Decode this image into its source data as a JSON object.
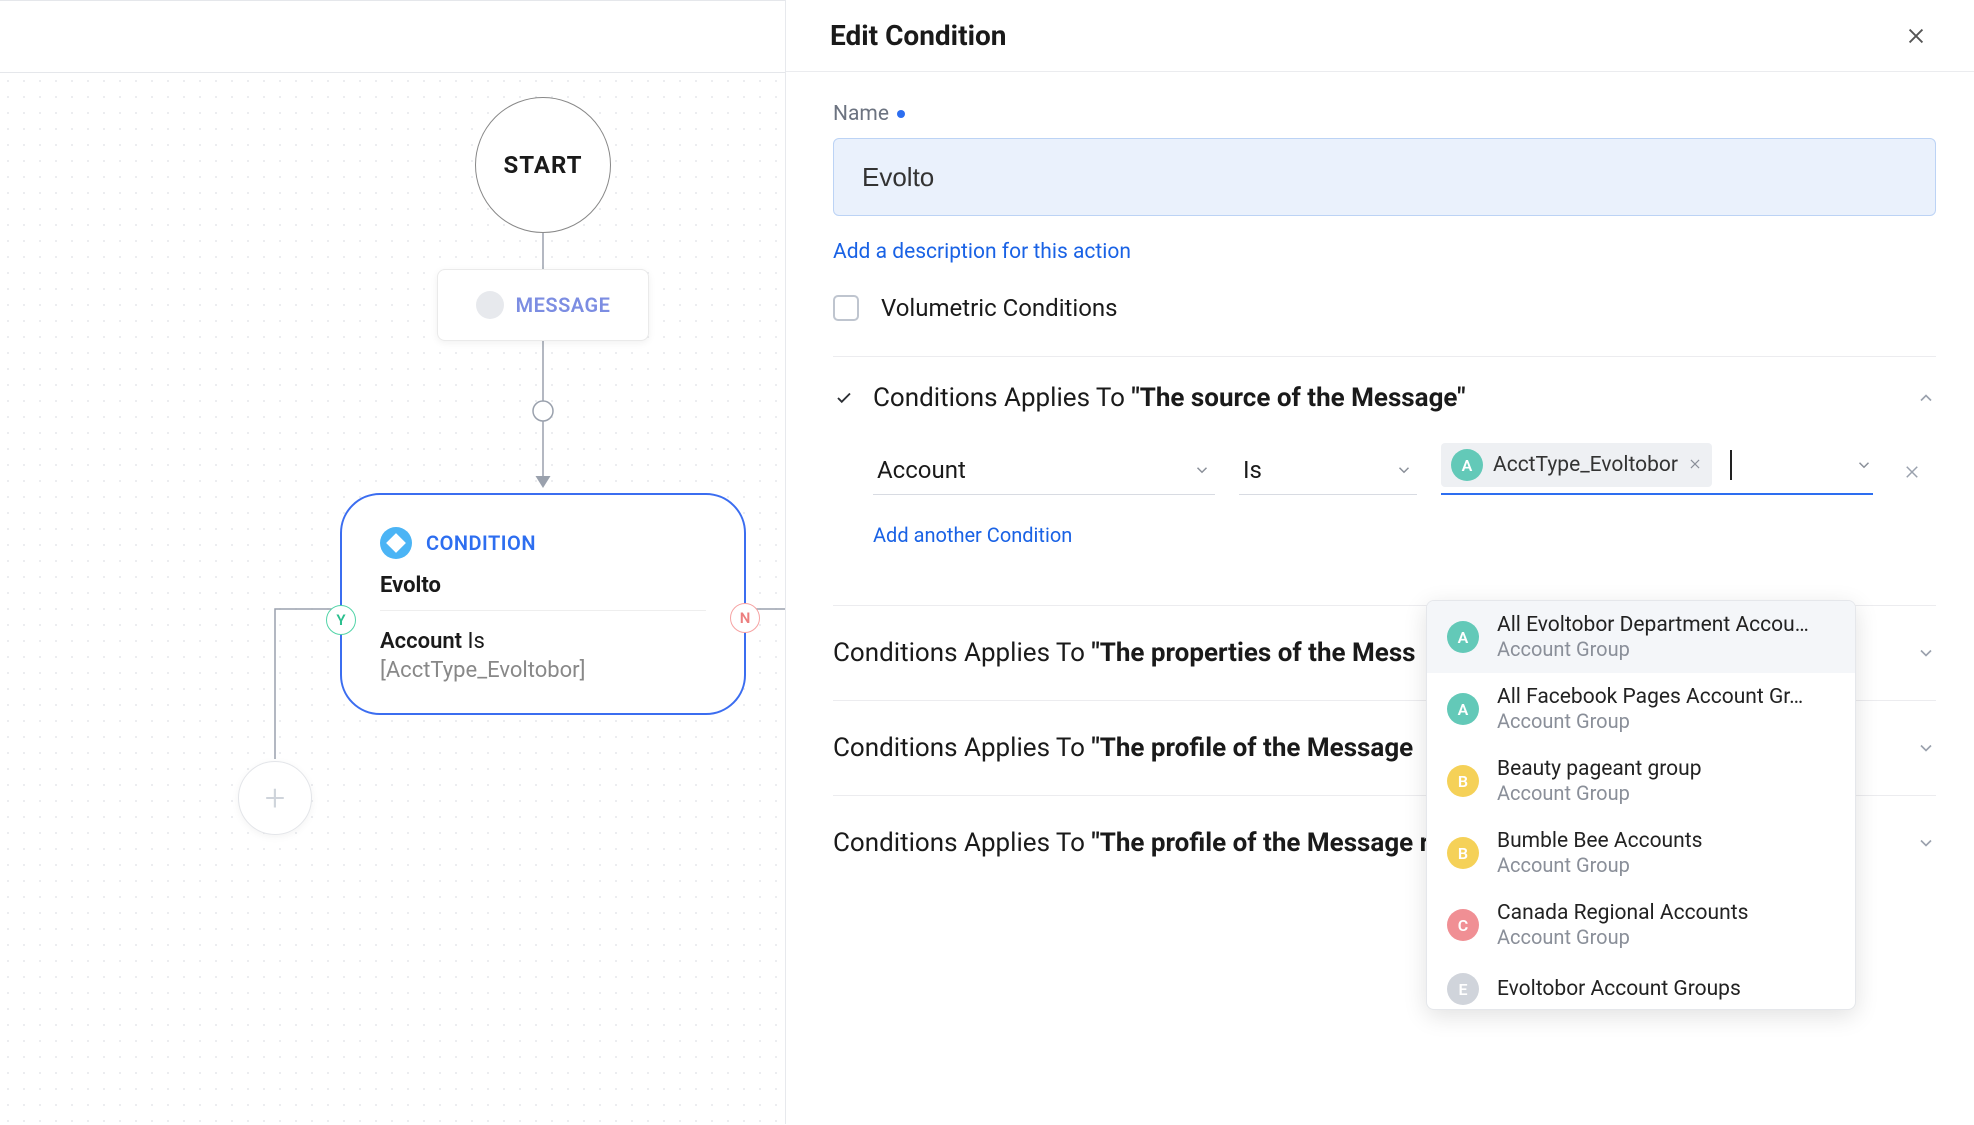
{
  "colors": {
    "accent": "#2d6ef0",
    "link": "#1962e5",
    "yes": "#2bbf8e",
    "no": "#ec7e7e"
  },
  "canvas": {
    "start_label": "START",
    "message_label": "MESSAGE",
    "add_button_glyph": "+",
    "yes_badge": "Y",
    "no_badge": "N",
    "condition_node": {
      "type_label": "CONDITION",
      "title": "Evolto",
      "field": "Account",
      "operator": "Is",
      "value_display": "[AcctType_Evoltobor]"
    }
  },
  "panel": {
    "title": "Edit Condition",
    "name_label": "Name",
    "name_value": "Evolto",
    "add_description": "Add a description for this action",
    "volumetric_label": "Volumetric Conditions",
    "volumetric_checked": false,
    "sections_prefix": "Conditions Applies To ",
    "section1": {
      "quoted": "\"The source of the Message\"",
      "field": {
        "label": "Account"
      },
      "operator": {
        "label": "Is"
      },
      "value_chip": {
        "letter": "A",
        "text": "AcctType_Evoltobor"
      },
      "add_another": "Add another Condition",
      "dropdown_options": [
        {
          "letter": "A",
          "color": "A",
          "name": "All Evoltobor Department Accou…",
          "sub": "Account Group"
        },
        {
          "letter": "A",
          "color": "A",
          "name": "All Facebook Pages Account Gr…",
          "sub": "Account Group"
        },
        {
          "letter": "B",
          "color": "B",
          "name": "Beauty pageant group",
          "sub": "Account Group"
        },
        {
          "letter": "B",
          "color": "B",
          "name": "Bumble Bee Accounts",
          "sub": "Account Group"
        },
        {
          "letter": "C",
          "color": "C",
          "name": "Canada Regional Accounts",
          "sub": "Account Group"
        },
        {
          "letter": "E",
          "color": "E",
          "name": "Evoltobor Account Groups",
          "sub": "Account Group"
        }
      ]
    },
    "section2": {
      "quoted": "\"The properties of the Mess"
    },
    "section3": {
      "quoted": "\"The profile of the Message"
    },
    "section4": {
      "quoted": "\"The profile of the Message receiver\""
    }
  }
}
